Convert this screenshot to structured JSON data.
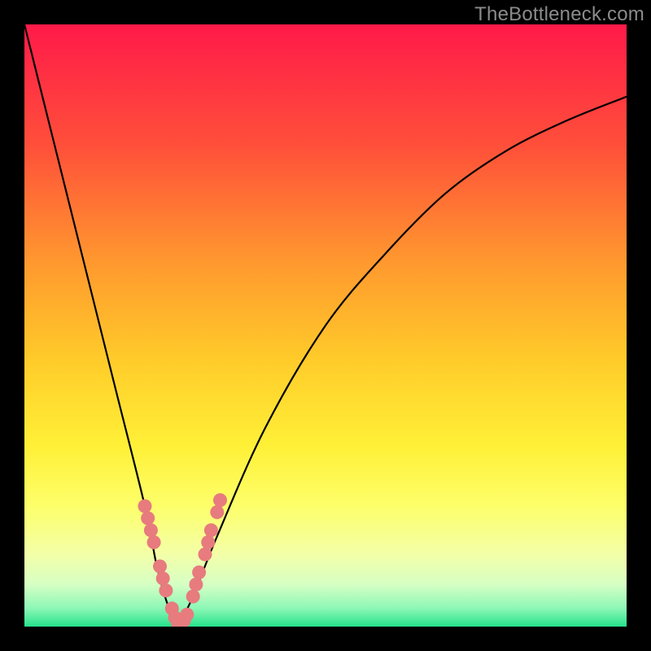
{
  "watermark": "TheBottleneck.com",
  "chart_data": {
    "type": "line",
    "title": "",
    "xlabel": "",
    "ylabel": "",
    "xlim": [
      0,
      100
    ],
    "ylim": [
      0,
      100
    ],
    "grid": false,
    "legend": false,
    "series": [
      {
        "name": "bottleneck-curve-left",
        "x": [
          0,
          5,
          10,
          15,
          20,
          22,
          24,
          25.5
        ],
        "y": [
          100,
          80,
          60,
          40,
          20,
          10,
          3,
          0
        ]
      },
      {
        "name": "bottleneck-curve-right",
        "x": [
          25.5,
          28,
          32,
          40,
          50,
          60,
          70,
          80,
          90,
          100
        ],
        "y": [
          0,
          5,
          15,
          33,
          50,
          62,
          72,
          79,
          84,
          88
        ]
      },
      {
        "name": "threshold-markers",
        "x": [
          20,
          20.5,
          21,
          21.5,
          22.5,
          23,
          23.5,
          24.5,
          25,
          25.5,
          26.5,
          27,
          28,
          28.5,
          29,
          30,
          30.5,
          31,
          32,
          32.5
        ],
        "y": [
          20,
          18,
          16,
          14,
          10,
          8,
          6,
          3,
          1.5,
          0.5,
          1,
          2,
          5,
          7,
          9,
          12,
          14,
          16,
          19,
          21
        ]
      }
    ],
    "background_gradient": {
      "stops": [
        {
          "offset": 0.0,
          "color": "#ff1a49"
        },
        {
          "offset": 0.2,
          "color": "#ff4f3a"
        },
        {
          "offset": 0.4,
          "color": "#ff9a2e"
        },
        {
          "offset": 0.56,
          "color": "#ffcc2a"
        },
        {
          "offset": 0.7,
          "color": "#fff037"
        },
        {
          "offset": 0.8,
          "color": "#fdff6a"
        },
        {
          "offset": 0.88,
          "color": "#f3ffa8"
        },
        {
          "offset": 0.93,
          "color": "#d6ffc4"
        },
        {
          "offset": 0.97,
          "color": "#8cf7b6"
        },
        {
          "offset": 1.0,
          "color": "#25e28b"
        }
      ]
    },
    "marker_color": "#e77b7e",
    "curve_stroke": "#000000"
  }
}
